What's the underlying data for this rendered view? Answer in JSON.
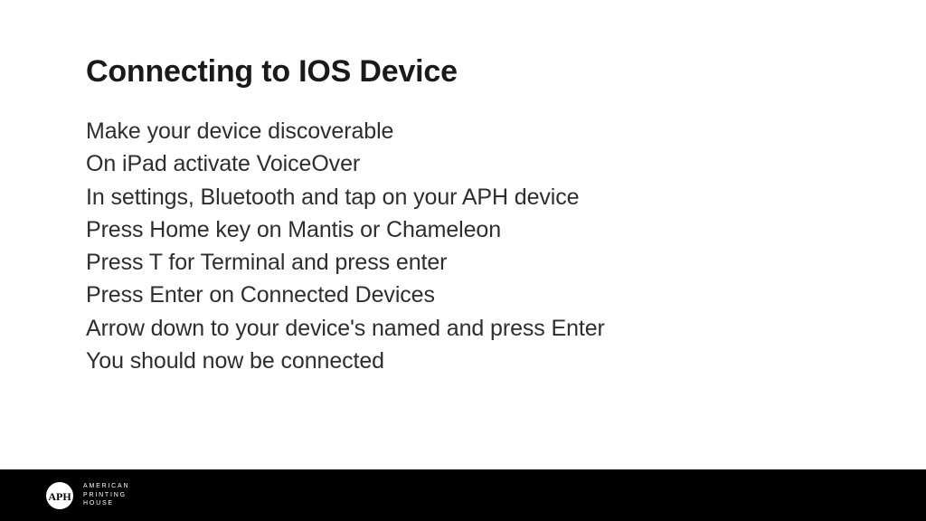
{
  "slide": {
    "title": "Connecting to IOS Device",
    "steps": [
      "Make your device discoverable",
      "On iPad activate VoiceOver",
      "In settings, Bluetooth and tap on your APH device",
      "Press Home key on Mantis or Chameleon",
      "Press T for Terminal and press enter",
      "Press Enter on Connected Devices",
      "Arrow down to your device's named and press Enter",
      "You should now be connected"
    ]
  },
  "footer": {
    "brand_line1": "AMERICAN",
    "brand_line2": "PRINTING",
    "brand_line3": "HOUSE"
  }
}
